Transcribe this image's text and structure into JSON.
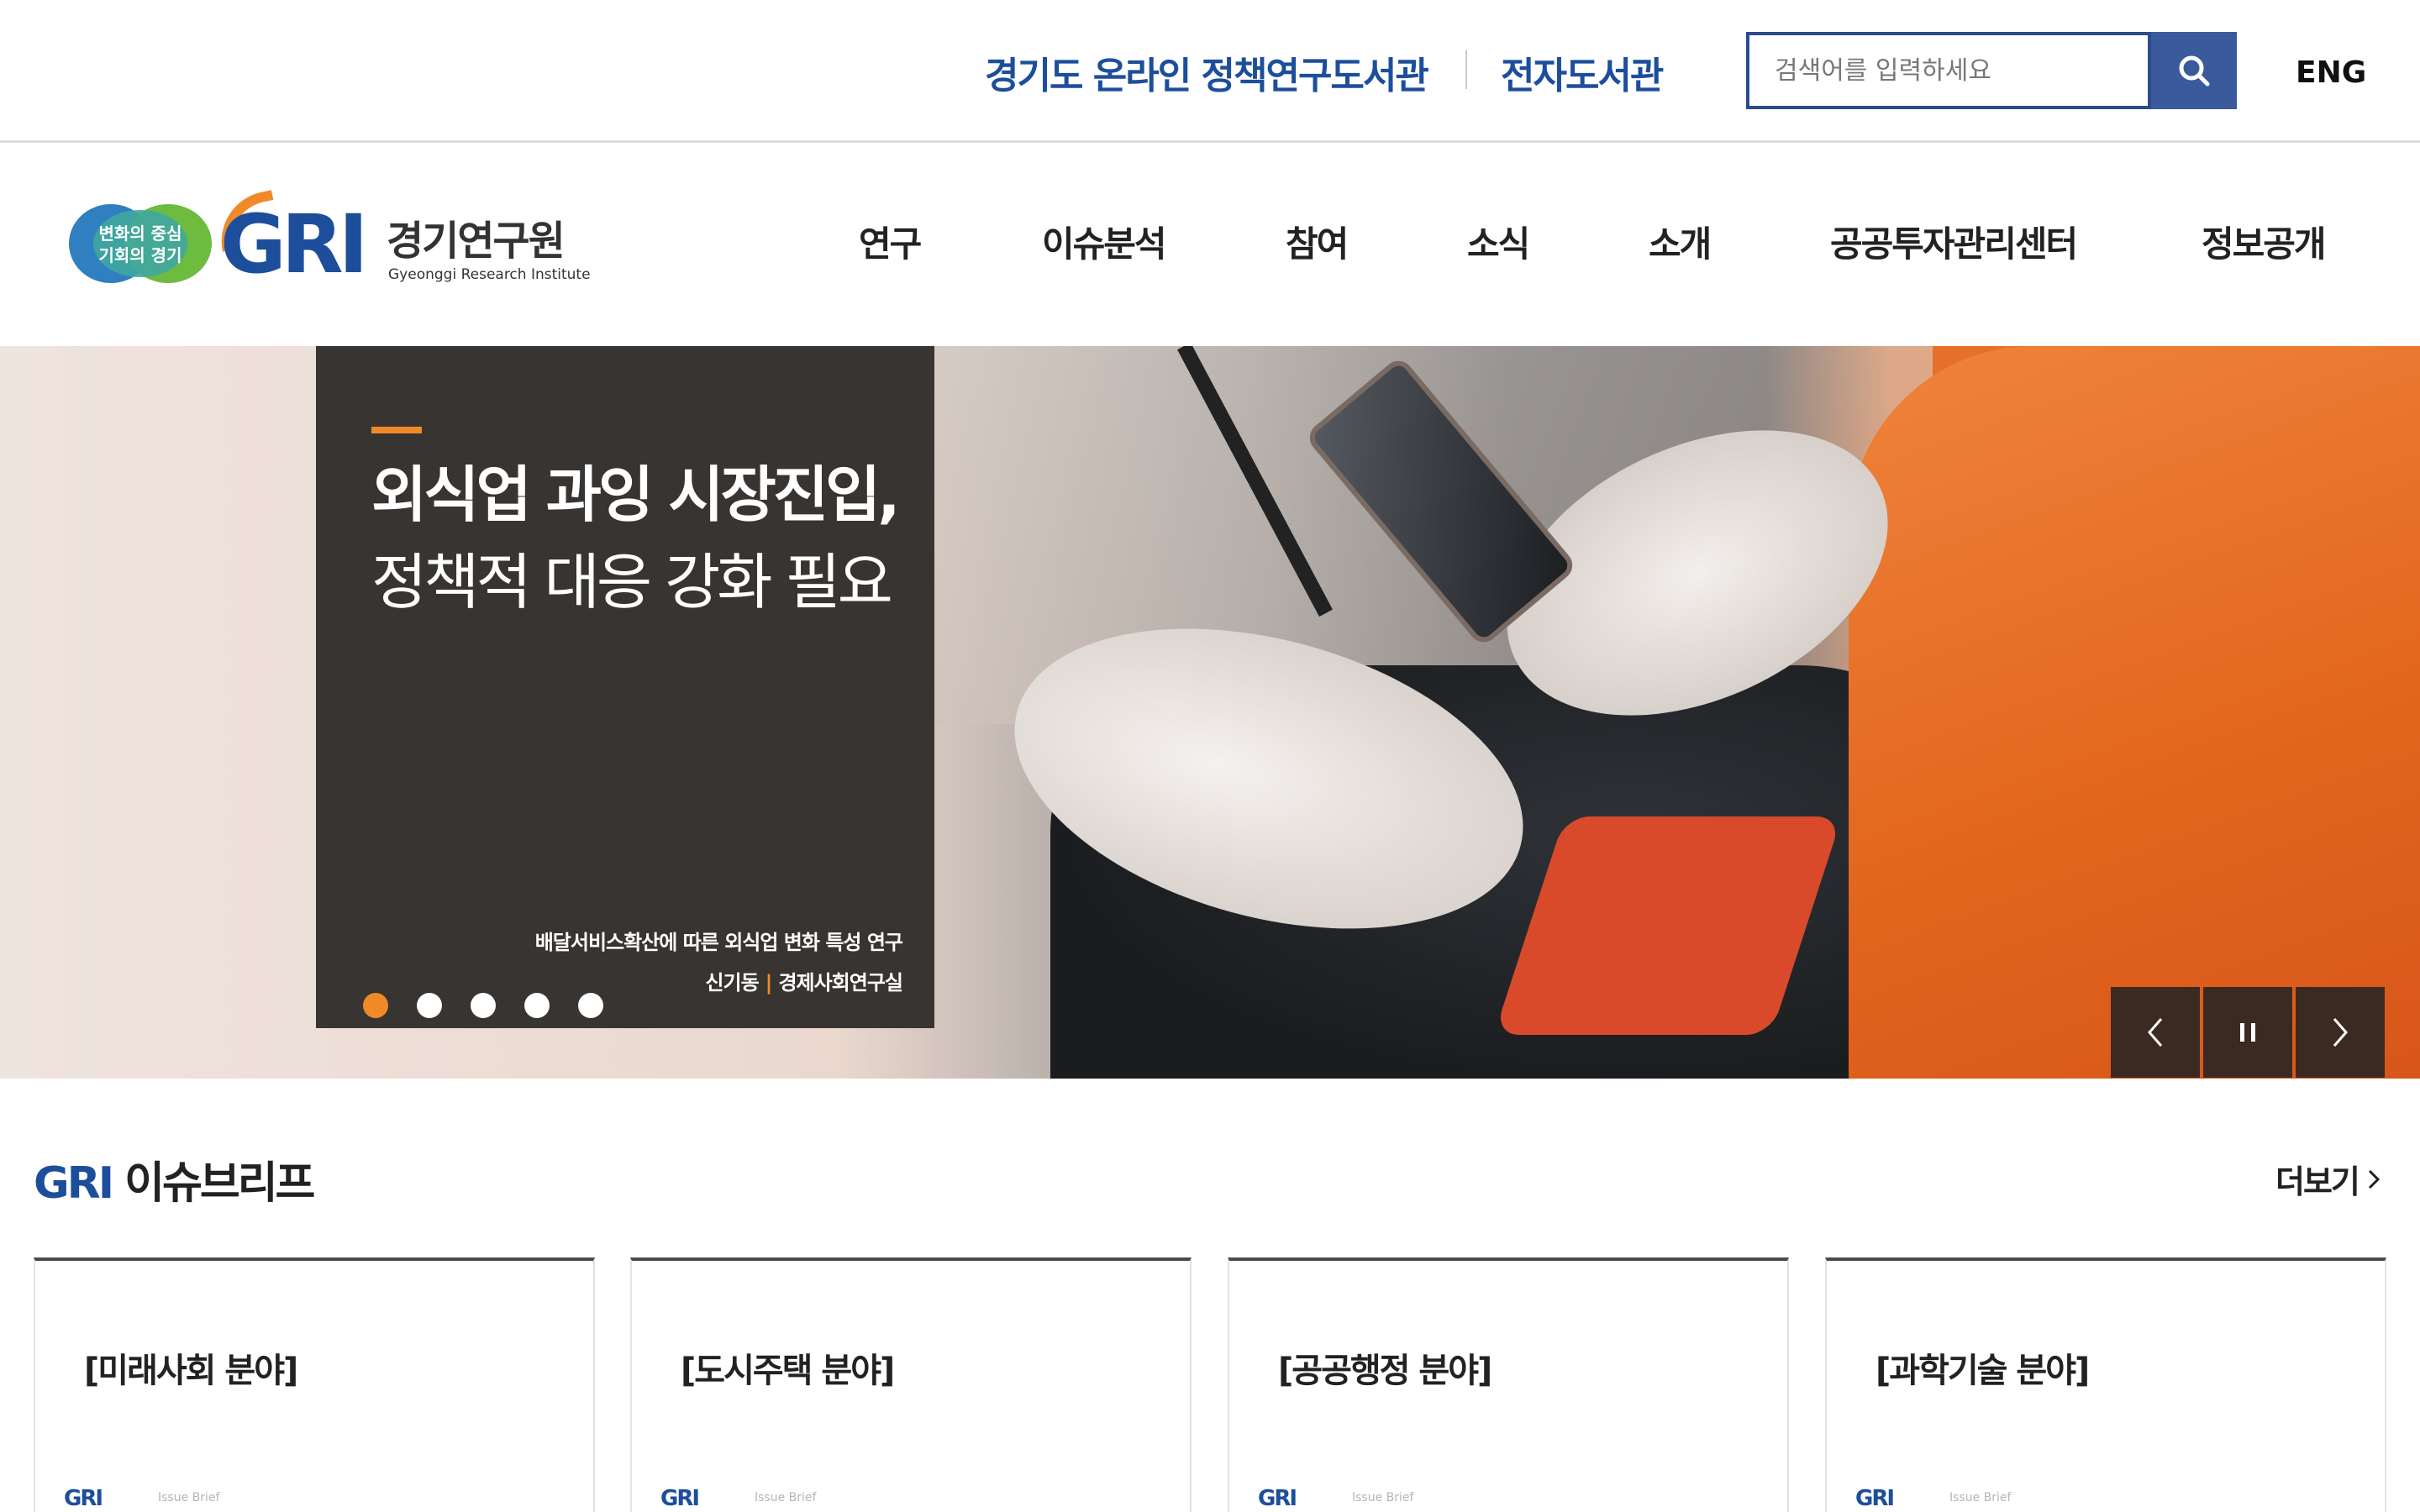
{
  "utility": {
    "library_link": "경기도 온라인 정책연구도서관",
    "ebook_link": "전자도서관",
    "search_placeholder": "검색어를 입력하세요",
    "search_icon": "search-icon",
    "lang_link": "ENG"
  },
  "logo": {
    "badge_line1": "변화의 중심",
    "badge_line2": "기회의 경기",
    "brand": "GRI",
    "name_ko": "경기연구원",
    "name_en": "Gyeonggi Research Institute"
  },
  "nav": [
    "연구",
    "이슈분석",
    "참여",
    "소식",
    "소개",
    "공공투자관리센터",
    "정보공개"
  ],
  "hero": {
    "title_line1": "외식업 과잉 시장진입,",
    "title_line2": "정책적 대응 강화 필요",
    "report_title": "배달서비스확산에 따른 외식업 변화 특성 연구",
    "author": "신기동",
    "department": "경제사회연구실",
    "slide_count": 5,
    "active_slide": 1,
    "accent_color": "#f08a28"
  },
  "issue_brief": {
    "title_brand": "GRI",
    "title_rest": " 이슈브리프",
    "more_label": "더보기",
    "cards": [
      {
        "title": "[미래사회 분야]",
        "logo": "GRI",
        "sub": "Issue Brief"
      },
      {
        "title": "[도시주택 분야]",
        "logo": "GRI",
        "sub": "Issue Brief"
      },
      {
        "title": "[공공행정 분야]",
        "logo": "GRI",
        "sub": "Issue Brief"
      },
      {
        "title": "[과학기술 분야]",
        "logo": "GRI",
        "sub": "Issue Brief"
      }
    ]
  },
  "colors": {
    "brand_blue": "#1d4e9c",
    "search_button": "#3a5a9c",
    "accent_orange": "#f08a28"
  }
}
